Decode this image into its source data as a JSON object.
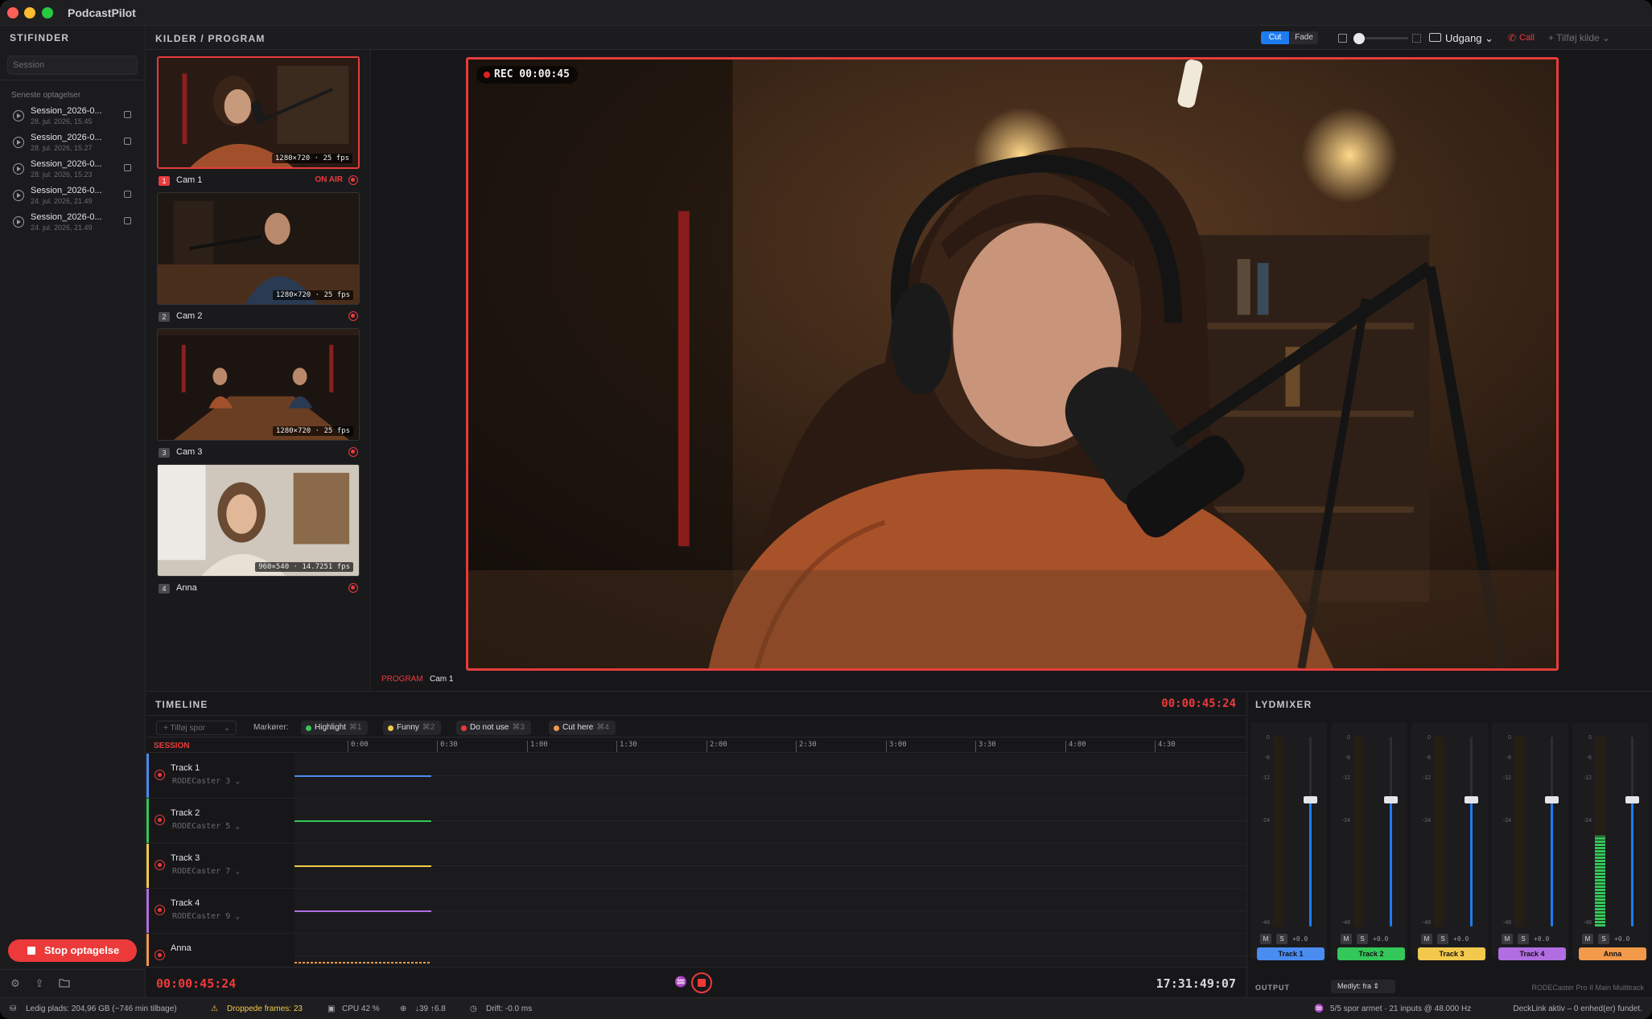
{
  "app": {
    "title": "PodcastPilot"
  },
  "sidebar": {
    "title": "STIFINDER",
    "search_placeholder": "Session",
    "recent_title": "Seneste optagelser",
    "recordings": [
      {
        "name": "Session_2026-0...",
        "date": "28. jul. 2026, 15.45"
      },
      {
        "name": "Session_2026-0...",
        "date": "28. jul. 2026, 15.27"
      },
      {
        "name": "Session_2026-0...",
        "date": "28. jul. 2026, 15.23"
      },
      {
        "name": "Session_2026-0...",
        "date": "24. jul. 2026, 21.49"
      },
      {
        "name": "Session_2026-0...",
        "date": "24. jul. 2026, 21.49"
      }
    ],
    "stop_label": "Stop optagelse"
  },
  "toolbar": {
    "title": "KILDER / PROGRAM",
    "cut_label": "Cut",
    "fade_label": "Fade",
    "output_label": "Udgang",
    "call_label": "Call",
    "add_source_label": "+ Tilføj kilde"
  },
  "cameras": [
    {
      "num": "1",
      "name": "Cam 1",
      "res": "1280×720 · 25 fps",
      "status": "ON AIR"
    },
    {
      "num": "2",
      "name": "Cam 2",
      "res": "1280×720 · 25 fps",
      "status": ""
    },
    {
      "num": "3",
      "name": "Cam 3",
      "res": "1280×720 · 25 fps",
      "status": ""
    },
    {
      "num": "4",
      "name": "Anna",
      "res": "960×540 · 14.7251 fps",
      "status": ""
    }
  ],
  "program": {
    "rec_label": "REC 00:00:45",
    "label": "PROGRAM",
    "source": "Cam 1"
  },
  "timeline": {
    "title": "TIMELINE",
    "timecode": "00:00:45:24",
    "add_track_label": "+ Tilføj spor",
    "markers_label": "Markører:",
    "markers": [
      {
        "label": "Highlight",
        "key": "⌘1",
        "color": "#34c759"
      },
      {
        "label": "Funny",
        "key": "⌘2",
        "color": "#f2c94c"
      },
      {
        "label": "Do not use",
        "key": "⌘3",
        "color": "#ec3a3a"
      },
      {
        "label": "Cut here",
        "key": "⌘4",
        "color": "#f2994a"
      }
    ],
    "session_label": "SESSION",
    "ticks": [
      "0:00",
      "0:30",
      "1:00",
      "1:30",
      "2:00",
      "2:30",
      "3:00",
      "3:30",
      "4:00",
      "4:30"
    ],
    "tracks": [
      {
        "name": "Track 1",
        "device": "RODECaster 3",
        "color": "#4a8cf0"
      },
      {
        "name": "Track 2",
        "device": "RODECaster 5",
        "color": "#34c759"
      },
      {
        "name": "Track 3",
        "device": "RODECaster 7",
        "color": "#f2c94c"
      },
      {
        "name": "Track 4",
        "device": "RODECaster 9",
        "color": "#b06ee0"
      },
      {
        "name": "Anna",
        "device": "",
        "color": "#f2994a"
      }
    ],
    "current_time": "00:00:45:24",
    "clock": "17:31:49:07"
  },
  "mixer": {
    "title": "LYDMIXER",
    "scale": [
      "0",
      "-6",
      "-12",
      "-24",
      "-48"
    ],
    "channels": [
      {
        "label": "Track 1",
        "color": "#4a8cf0",
        "gain": "+0.0",
        "level": 0.0
      },
      {
        "label": "Track 2",
        "color": "#34c759",
        "gain": "+0.0",
        "level": 0.0
      },
      {
        "label": "Track 3",
        "color": "#f2c94c",
        "gain": "+0.0",
        "level": 0.0
      },
      {
        "label": "Track 4",
        "color": "#b06ee0",
        "gain": "+0.0",
        "level": 0.0
      },
      {
        "label": "Anna",
        "color": "#f2994a",
        "gain": "+0.0",
        "level": 0.48
      }
    ],
    "mute_label": "M",
    "solo_label": "S",
    "output_label": "OUTPUT",
    "monitor_select": "Medlyt: fra",
    "device_label": "RODECaster Pro II Main Multitrack"
  },
  "status": {
    "disk": "Ledig plads: 204,96 GB (~746 min tilbage)",
    "dropped": "Droppede frames: 23",
    "cpu": "CPU 42 %",
    "net": "↓39 ↑6.8",
    "drift": "Drift: -0.0 ms",
    "tracks": "5/5 spor armet · 21 inputs @ 48.000 Hz",
    "decklink": "DeckLink aktiv – 0 enhed(er) fundet."
  }
}
